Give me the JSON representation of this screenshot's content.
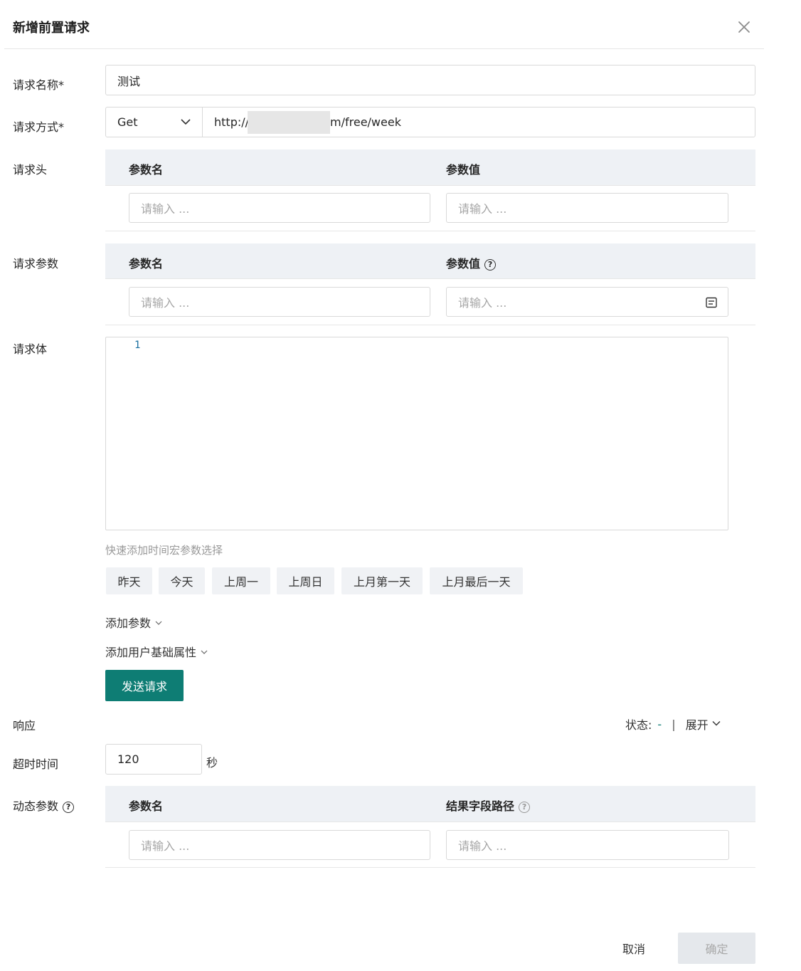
{
  "dialog": {
    "title": "新增前置请求"
  },
  "form": {
    "name_label": "请求名称*",
    "name_value": "测试",
    "method_label": "请求方式*",
    "method_value": "Get",
    "url_prefix": "http://",
    "url_suffix": "m/free/week",
    "headers_label": "请求头",
    "params_label": "请求参数",
    "body_label": "请求体",
    "body_line_number": "1",
    "response_label": "响应",
    "timeout_label": "超时时间",
    "timeout_value": "120",
    "timeout_unit": "秒",
    "dynamic_label": "动态参数"
  },
  "headers_table": {
    "col_name": "参数名",
    "col_value": "参数值",
    "name_placeholder": "请输入 ...",
    "value_placeholder": "请输入 ..."
  },
  "params_table": {
    "col_name": "参数名",
    "col_value": "参数值",
    "name_placeholder": "请输入 ...",
    "value_placeholder": "请输入 ..."
  },
  "quick_macros": {
    "hint": "快速添加时间宏参数选择",
    "chips": [
      "昨天",
      "今天",
      "上周一",
      "上周日",
      "上月第一天",
      "上月最后一天"
    ]
  },
  "links": {
    "add_param": "添加参数",
    "add_user_attr": "添加用户基础属性"
  },
  "send_button": "发送请求",
  "response": {
    "status_label": "状态:",
    "status_value": "-",
    "separator": "|",
    "expand": "展开"
  },
  "dynamic_table": {
    "col_name": "参数名",
    "col_path": "结果字段路径",
    "name_placeholder": "请输入 ...",
    "path_placeholder": "请输入 ..."
  },
  "footer": {
    "cancel": "取消",
    "ok": "确定"
  },
  "colors": {
    "primary": "#0e7d74",
    "table_header_bg": "#eef1f5",
    "chip_bg": "#f0f2f5",
    "disabled_bg": "#e5e8ec"
  }
}
